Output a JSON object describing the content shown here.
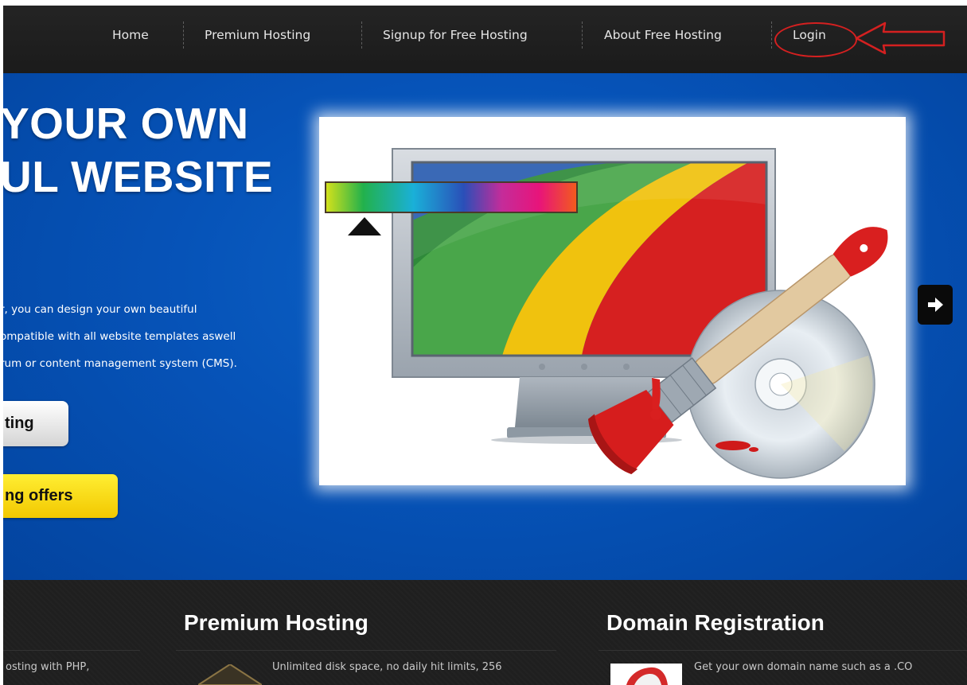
{
  "nav": {
    "items": [
      "Home",
      "Premium Hosting",
      "Signup for Free Hosting",
      "About Free Hosting",
      "Login"
    ]
  },
  "hero": {
    "title_line1": "YOUR OWN",
    "title_line2": "UL WEBSITE",
    "text_line1": "r, you can design your own beautiful",
    "text_line2": "ompatible with all website templates aswell",
    "text_line3": "rum or content management system (CMS).",
    "button_primary": "ting",
    "button_offers": "ng offers"
  },
  "sections": {
    "left_text": "osting with PHP,",
    "premium_title": "Premium Hosting",
    "premium_text": "Unlimited disk space, no daily hit limits, 256",
    "domain_title": "Domain Registration",
    "domain_text": "Get your own domain name such as a .CO"
  },
  "colors": {
    "nav_bg": "#1e1e1e",
    "hero_blue": "#0653b8",
    "annotation_red": "#d42020",
    "offers_yellow": "#f5d400"
  }
}
